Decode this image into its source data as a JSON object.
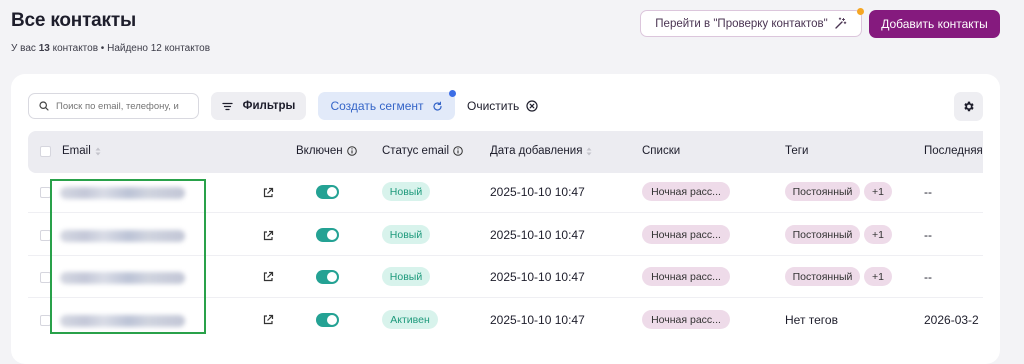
{
  "header": {
    "title": "Все контакты",
    "subtitle_prefix": "У вас",
    "total_count": "13",
    "subtitle_middle": "контактов",
    "found_text": "Найдено 12 контактов",
    "check_button": "Перейти в \"Проверку контактов\"",
    "add_button": "Добавить контакты",
    "accent_color": "#851a7e"
  },
  "toolbar": {
    "search_placeholder": "Поиск по email, телефону, и",
    "filters_label": "Фильтры",
    "segment_label": "Создать сегмент",
    "clear_label": "Очистить"
  },
  "table": {
    "columns": [
      "Email",
      "Включен",
      "Статус email",
      "Дата добавления",
      "Списки",
      "Теги",
      "Последняя"
    ],
    "rows": [
      {
        "enabled": true,
        "status": "Новый",
        "date": "2025-10-10 10:47",
        "list": "Ночная расс...",
        "tag": "Постоянный",
        "tag_more": "+1",
        "last": "--"
      },
      {
        "enabled": true,
        "status": "Новый",
        "date": "2025-10-10 10:47",
        "list": "Ночная расс...",
        "tag": "Постоянный",
        "tag_more": "+1",
        "last": "--"
      },
      {
        "enabled": true,
        "status": "Новый",
        "date": "2025-10-10 10:47",
        "list": "Ночная расс...",
        "tag": "Постоянный",
        "tag_more": "+1",
        "last": "--"
      },
      {
        "enabled": true,
        "status": "Активен",
        "date": "2025-10-10 10:47",
        "list": "Ночная расс...",
        "tags_text": "Нет тегов",
        "last": "2026-03-2"
      }
    ]
  }
}
